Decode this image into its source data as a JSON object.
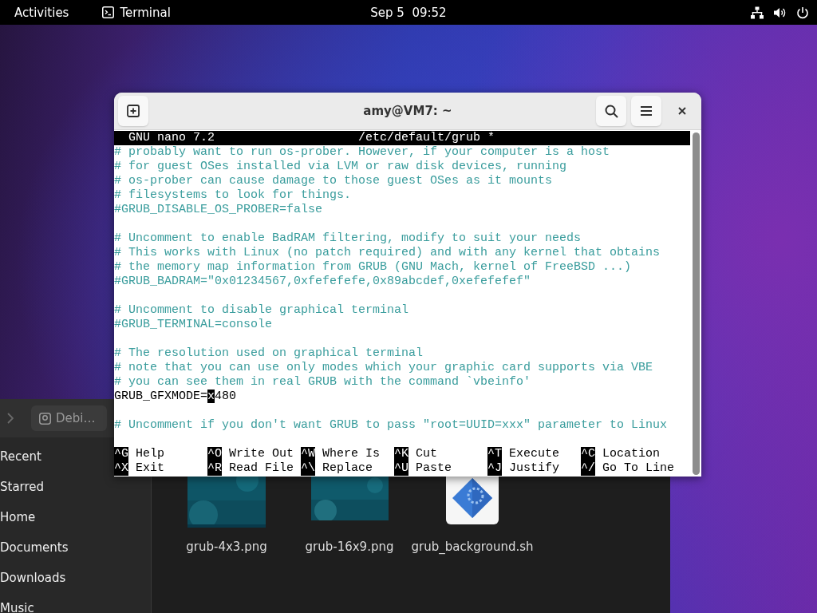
{
  "top_bar": {
    "activities": "Activities",
    "app": "Terminal",
    "clock": "Sep 5  09:52"
  },
  "files_window": {
    "path_button": "Debi…",
    "sidebar": [
      "Recent",
      "Starred",
      "Home",
      "Documents",
      "Downloads",
      "Music"
    ],
    "files": [
      {
        "name": "grub-4x3.png"
      },
      {
        "name": "grub-16x9.png",
        "kind": "wide-image"
      },
      {
        "name": "grub_background.sh",
        "kind": "script"
      }
    ]
  },
  "terminal": {
    "title": "amy@VM7: ~",
    "nano": {
      "app": "GNU nano 7.2",
      "file": "/etc/default/grub *",
      "lines": [
        {
          "kind": "comment",
          "text": "# probably want to run os-prober. However, if your computer is a host"
        },
        {
          "kind": "comment",
          "text": "# for guest OSes installed via LVM or raw disk devices, running"
        },
        {
          "kind": "comment",
          "text": "# os-prober can cause damage to those guest OSes as it mounts"
        },
        {
          "kind": "comment",
          "text": "# filesystems to look for things."
        },
        {
          "kind": "comment",
          "text": "#GRUB_DISABLE_OS_PROBER=false"
        },
        {
          "kind": "blank"
        },
        {
          "kind": "comment",
          "text": "# Uncomment to enable BadRAM filtering, modify to suit your needs"
        },
        {
          "kind": "comment",
          "text": "# This works with Linux (no patch required) and with any kernel that obtains"
        },
        {
          "kind": "comment",
          "text": "# the memory map information from GRUB (GNU Mach, kernel of FreeBSD ...)"
        },
        {
          "kind": "comment",
          "text": "#GRUB_BADRAM=\"0x01234567,0xfefefefe,0x89abcdef,0xefefefef\""
        },
        {
          "kind": "blank"
        },
        {
          "kind": "comment",
          "text": "# Uncomment to disable graphical terminal"
        },
        {
          "kind": "comment",
          "text": "#GRUB_TERMINAL=console"
        },
        {
          "kind": "blank"
        },
        {
          "kind": "comment",
          "text": "# The resolution used on graphical terminal"
        },
        {
          "kind": "comment",
          "text": "# note that you can use only modes which your graphic card supports via VBE"
        },
        {
          "kind": "comment",
          "text": "# you can see them in real GRUB with the command `vbeinfo'"
        },
        {
          "kind": "code",
          "text": "GRUB_GFXMODE=",
          "cursor": "x",
          "rest": "480"
        },
        {
          "kind": "blank"
        },
        {
          "kind": "comment",
          "text": "# Uncomment if you don't want GRUB to pass \"root=UUID=xxx\" parameter to Linux"
        },
        {
          "kind": "blank"
        }
      ],
      "shortcut_rows": [
        [
          {
            "key": "^G",
            "label": "Help"
          },
          {
            "key": "^O",
            "label": "Write Out"
          },
          {
            "key": "^W",
            "label": "Where Is"
          },
          {
            "key": "^K",
            "label": "Cut"
          },
          {
            "key": "^T",
            "label": "Execute"
          },
          {
            "key": "^C",
            "label": "Location"
          }
        ],
        [
          {
            "key": "^X",
            "label": "Exit"
          },
          {
            "key": "^R",
            "label": "Read File"
          },
          {
            "key": "^\\",
            "label": "Replace"
          },
          {
            "key": "^U",
            "label": "Paste"
          },
          {
            "key": "^J",
            "label": "Justify"
          },
          {
            "key": "^/",
            "label": "Go To Line"
          }
        ]
      ]
    }
  }
}
